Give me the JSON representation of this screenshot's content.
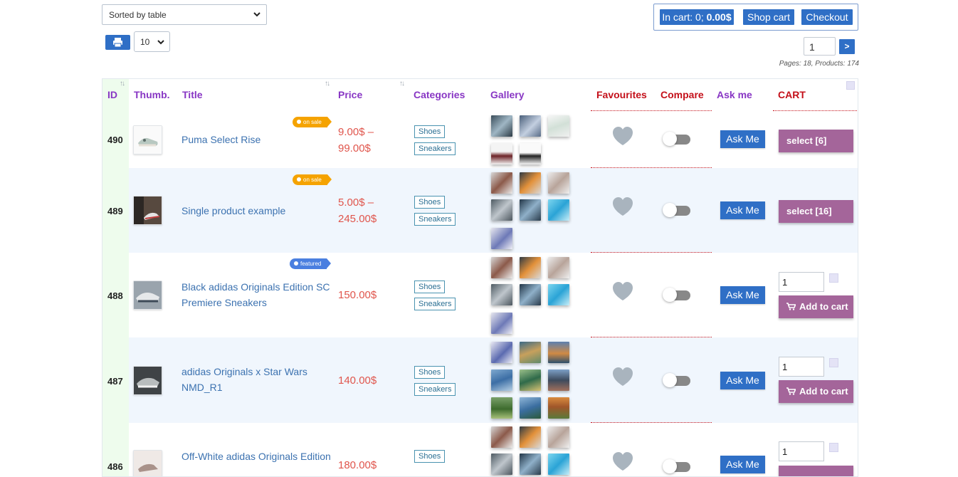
{
  "top": {
    "sort_value": "Sorted by table",
    "per_page_value": "10",
    "cart_label": "In cart: 0;",
    "cart_total": "0.00$",
    "shop_cart": "Shop cart",
    "checkout": "Checkout",
    "page_input": "1",
    "page_go": ">",
    "pages_info": "Pages: 18, Products: 174"
  },
  "headers": {
    "id": "ID",
    "thumb": "Thumb.",
    "title": "Title",
    "price": "Price",
    "categories": "Categories",
    "gallery": "Gallery",
    "favourites": "Favourites",
    "compare": "Compare",
    "ask_me": "Ask me",
    "cart": "CART"
  },
  "colors": {
    "accent_blue": "#2f6fc6",
    "header_purple": "#8836c4",
    "header_red": "#c4101a",
    "cart_purple": "#a4659a",
    "price_red": "#e0554c"
  },
  "rows": [
    {
      "id": "490",
      "title": "Puma Select Rise",
      "price": "9.00$ – 99.00$",
      "tag": "on sale",
      "categories": [
        "Shoes",
        "Sneakers"
      ],
      "ask": "Ask Me",
      "cart_button": "select [6]"
    },
    {
      "id": "489",
      "title": "Single product example",
      "price": "5.00$ – 245.00$",
      "tag": "on sale",
      "categories": [
        "Shoes",
        "Sneakers"
      ],
      "ask": "Ask Me",
      "cart_button": "select [16]"
    },
    {
      "id": "488",
      "title": "Black adidas Originals Edition SC Premiere Sneakers",
      "price": "150.00$",
      "tag": "featured",
      "categories": [
        "Shoes",
        "Sneakers"
      ],
      "ask": "Ask Me",
      "qty": "1",
      "cart_button": "Add to cart"
    },
    {
      "id": "487",
      "title": "adidas Originals x Star Wars NMD_R1",
      "price": "140.00$",
      "categories": [
        "Shoes",
        "Sneakers"
      ],
      "ask": "Ask Me",
      "qty": "1",
      "cart_button": "Add to cart"
    },
    {
      "id": "486",
      "title": "Off-White adidas Originals Edition",
      "price": "180.00$",
      "categories": [
        "Shoes"
      ],
      "ask": "Ask Me",
      "qty": "1"
    }
  ]
}
